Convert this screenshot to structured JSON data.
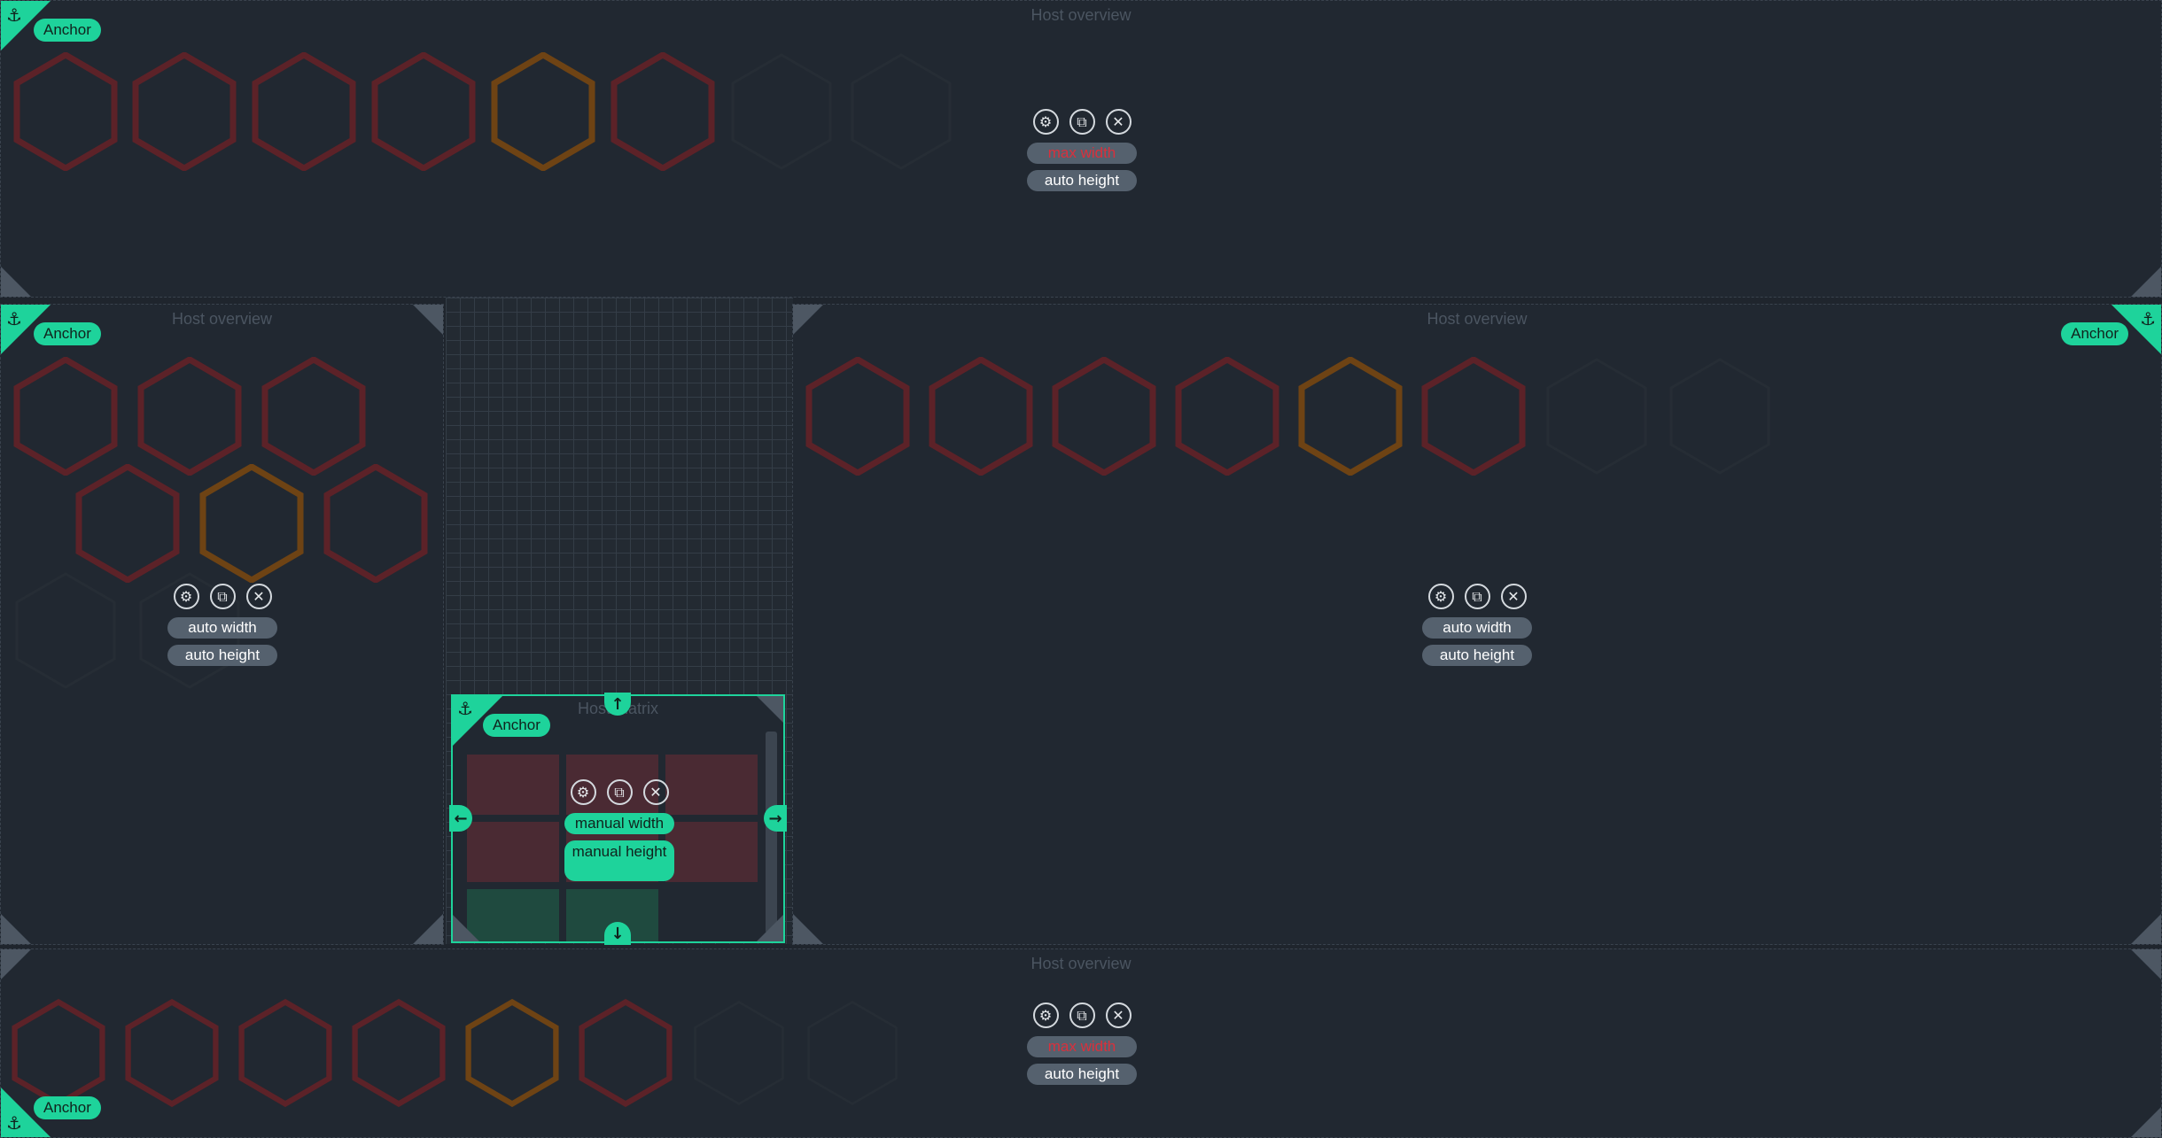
{
  "colors": {
    "background": "#1f252d",
    "accent": "#1ed39b",
    "hex_critical": "#5c2228",
    "hex_warning": "#6e4314",
    "hex_empty": "#262d35",
    "cell_critical": "#4a2a33",
    "cell_ok": "#1f4a3f",
    "error_text": "#d9303c"
  },
  "icons": [
    "anchor-icon",
    "gear-icon",
    "clone-icon",
    "close-icon",
    "arrow-up-icon",
    "arrow-down-icon",
    "arrow-left-icon",
    "arrow-right-icon"
  ],
  "dashlets": {
    "top": {
      "title": "Host overview",
      "anchor": "Anchor",
      "width_label": "max width",
      "height_label": "auto height"
    },
    "left": {
      "title": "Host overview",
      "anchor": "Anchor",
      "width_label": "auto width",
      "height_label": "auto height"
    },
    "right": {
      "title": "Host overview",
      "anchor": "Anchor",
      "width_label": "auto width",
      "height_label": "auto height"
    },
    "matrix": {
      "title": "Host matrix",
      "anchor": "Anchor",
      "width_label": "manual width",
      "height_label": "manual height"
    },
    "bottom": {
      "title": "Host overview",
      "anchor": "Anchor",
      "width_label": "max width",
      "height_label": "auto height"
    }
  },
  "hex_states": {
    "top": [
      "critical",
      "critical",
      "critical",
      "critical",
      "warning",
      "critical",
      "empty",
      "empty"
    ],
    "left": [
      "critical",
      "critical",
      "critical",
      "critical",
      "warning",
      "critical",
      "empty",
      "empty"
    ],
    "right": [
      "critical",
      "critical",
      "critical",
      "critical",
      "warning",
      "critical",
      "empty",
      "empty"
    ],
    "bottom": [
      "critical",
      "critical",
      "critical",
      "critical",
      "warning",
      "critical",
      "empty",
      "empty"
    ]
  },
  "matrix_cells": [
    "critical",
    "critical",
    "critical",
    "critical",
    "critical",
    "critical",
    "ok",
    "ok"
  ]
}
